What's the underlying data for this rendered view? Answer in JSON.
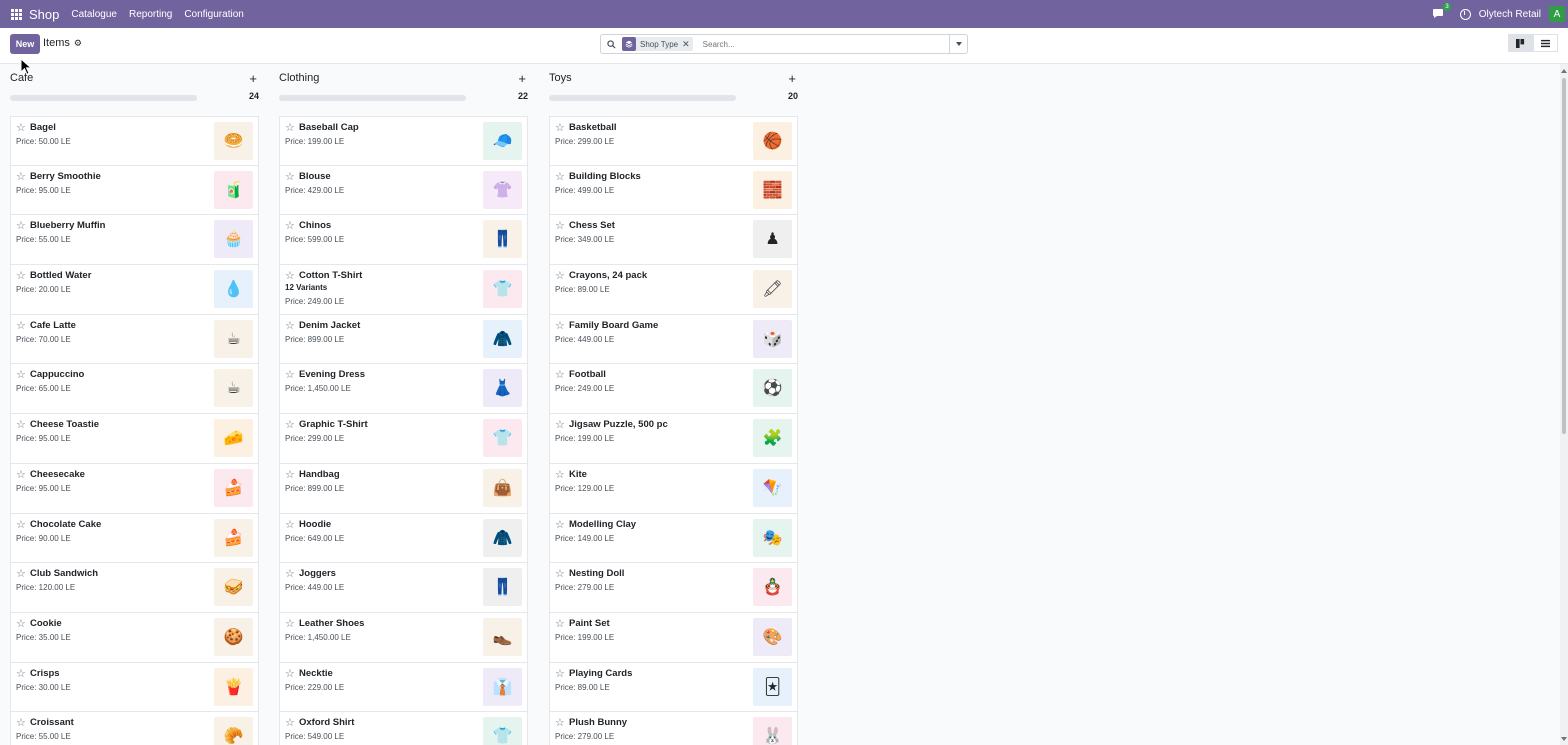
{
  "navbar": {
    "brand": "Shop",
    "menu": [
      "Catalogue",
      "Reporting",
      "Configuration"
    ],
    "chat_badge": "3",
    "company": "Olytech Retail",
    "avatar_letter": "A"
  },
  "control": {
    "new_label": "New",
    "breadcrumb": "Items",
    "facet_label": "Shop Type",
    "search_placeholder": "Search..."
  },
  "colors": {
    "brand": "#71639e"
  },
  "columns": [
    {
      "title": "Cafe",
      "count": "24",
      "cards": [
        {
          "name": "Bagel",
          "price": "Price: 50.00 LE",
          "icon": "🥯",
          "bg": "#f8f1e7"
        },
        {
          "name": "Berry Smoothie",
          "price": "Price: 95.00 LE",
          "icon": "🧃",
          "bg": "#fbe9ef"
        },
        {
          "name": "Blueberry Muffin",
          "price": "Price: 55.00 LE",
          "icon": "🧁",
          "bg": "#efeaf8"
        },
        {
          "name": "Bottled Water",
          "price": "Price: 20.00 LE",
          "icon": "💧",
          "bg": "#e6f1fb"
        },
        {
          "name": "Cafe Latte",
          "price": "Price: 70.00 LE",
          "icon": "☕",
          "bg": "#f8f1e7"
        },
        {
          "name": "Cappuccino",
          "price": "Price: 65.00 LE",
          "icon": "☕",
          "bg": "#f8f1e7"
        },
        {
          "name": "Cheese Toastie",
          "price": "Price: 95.00 LE",
          "icon": "🧀",
          "bg": "#fbf0e1"
        },
        {
          "name": "Cheesecake",
          "price": "Price: 95.00 LE",
          "icon": "🍰",
          "bg": "#fbe9ef"
        },
        {
          "name": "Chocolate Cake",
          "price": "Price: 90.00 LE",
          "icon": "🍰",
          "bg": "#f8f1e7"
        },
        {
          "name": "Club Sandwich",
          "price": "Price: 120.00 LE",
          "icon": "🥪",
          "bg": "#f8f1e7"
        },
        {
          "name": "Cookie",
          "price": "Price: 35.00 LE",
          "icon": "🍪",
          "bg": "#f8f1e7"
        },
        {
          "name": "Crisps",
          "price": "Price: 30.00 LE",
          "icon": "🍟",
          "bg": "#fbf0e1"
        },
        {
          "name": "Croissant",
          "price": "Price: 55.00 LE",
          "icon": "🥐",
          "bg": "#f8f1e7"
        }
      ]
    },
    {
      "title": "Clothing",
      "count": "22",
      "cards": [
        {
          "name": "Baseball Cap",
          "price": "Price: 199.00 LE",
          "icon": "🧢",
          "bg": "#e6f4ef"
        },
        {
          "name": "Blouse",
          "price": "Price: 429.00 LE",
          "icon": "👚",
          "bg": "#f6e9f8"
        },
        {
          "name": "Chinos",
          "price": "Price: 599.00 LE",
          "icon": "👖",
          "bg": "#f8f1e7"
        },
        {
          "name": "Cotton T-Shirt",
          "variants": "12 Variants",
          "price": "Price: 249.00 LE",
          "icon": "👕",
          "bg": "#fbe9ef"
        },
        {
          "name": "Denim Jacket",
          "price": "Price: 899.00 LE",
          "icon": "🧥",
          "bg": "#e6f1fb"
        },
        {
          "name": "Evening Dress",
          "price": "Price: 1,450.00 LE",
          "icon": "👗",
          "bg": "#efeaf8"
        },
        {
          "name": "Graphic T-Shirt",
          "price": "Price: 299.00 LE",
          "icon": "👕",
          "bg": "#fbe9ef"
        },
        {
          "name": "Handbag",
          "price": "Price: 899.00 LE",
          "icon": "👜",
          "bg": "#f8f1e7"
        },
        {
          "name": "Hoodie",
          "price": "Price: 649.00 LE",
          "icon": "🧥",
          "bg": "#efefef"
        },
        {
          "name": "Joggers",
          "price": "Price: 449.00 LE",
          "icon": "👖",
          "bg": "#efefef"
        },
        {
          "name": "Leather Shoes",
          "price": "Price: 1,450.00 LE",
          "icon": "👞",
          "bg": "#f8f1e7"
        },
        {
          "name": "Necktie",
          "price": "Price: 229.00 LE",
          "icon": "👔",
          "bg": "#efeaf8"
        },
        {
          "name": "Oxford Shirt",
          "price": "Price: 549.00 LE",
          "icon": "👕",
          "bg": "#e6f4ef"
        }
      ]
    },
    {
      "title": "Toys",
      "count": "20",
      "cards": [
        {
          "name": "Basketball",
          "price": "Price: 299.00 LE",
          "icon": "🏀",
          "bg": "#fbf0e1"
        },
        {
          "name": "Building Blocks",
          "price": "Price: 499.00 LE",
          "icon": "🧱",
          "bg": "#fbf0e1"
        },
        {
          "name": "Chess Set",
          "price": "Price: 349.00 LE",
          "icon": "♟",
          "bg": "#efefef"
        },
        {
          "name": "Crayons, 24 pack",
          "price": "Price: 89.00 LE",
          "icon": "🖍",
          "bg": "#f8f1e7"
        },
        {
          "name": "Family Board Game",
          "price": "Price: 449.00 LE",
          "icon": "🎲",
          "bg": "#efeaf8"
        },
        {
          "name": "Football",
          "price": "Price: 249.00 LE",
          "icon": "⚽",
          "bg": "#e6f4ef"
        },
        {
          "name": "Jigsaw Puzzle, 500 pc",
          "price": "Price: 199.00 LE",
          "icon": "🧩",
          "bg": "#e6f4ef"
        },
        {
          "name": "Kite",
          "price": "Price: 129.00 LE",
          "icon": "🪁",
          "bg": "#e6f1fb"
        },
        {
          "name": "Modelling Clay",
          "price": "Price: 149.00 LE",
          "icon": "🎭",
          "bg": "#e6f4ef"
        },
        {
          "name": "Nesting Doll",
          "price": "Price: 279.00 LE",
          "icon": "🪆",
          "bg": "#fbe9ef"
        },
        {
          "name": "Paint Set",
          "price": "Price: 199.00 LE",
          "icon": "🎨",
          "bg": "#efeaf8"
        },
        {
          "name": "Playing Cards",
          "price": "Price: 89.00 LE",
          "icon": "🃏",
          "bg": "#e6f1fb"
        },
        {
          "name": "Plush Bunny",
          "price": "Price: 279.00 LE",
          "icon": "🐰",
          "bg": "#fbe9ef"
        }
      ]
    }
  ]
}
